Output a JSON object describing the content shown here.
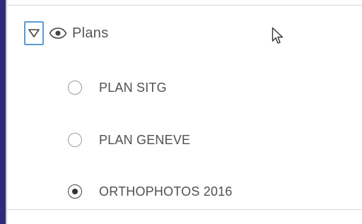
{
  "layer_group": {
    "title": "Plans",
    "expanded": true,
    "visible": true
  },
  "layers": [
    {
      "label": "PLAN SITG",
      "selected": false
    },
    {
      "label": "PLAN GENEVE",
      "selected": false
    },
    {
      "label": "ORTHOPHOTOS 2016",
      "selected": true
    }
  ],
  "icons": {
    "expand": "triangle-down-icon",
    "visibility": "eye-icon",
    "pointer": "mouse-cursor-icon"
  },
  "colors": {
    "toggle_border": "#5b9bd5",
    "panel_edge": "#312a7a",
    "text": "#555555"
  }
}
